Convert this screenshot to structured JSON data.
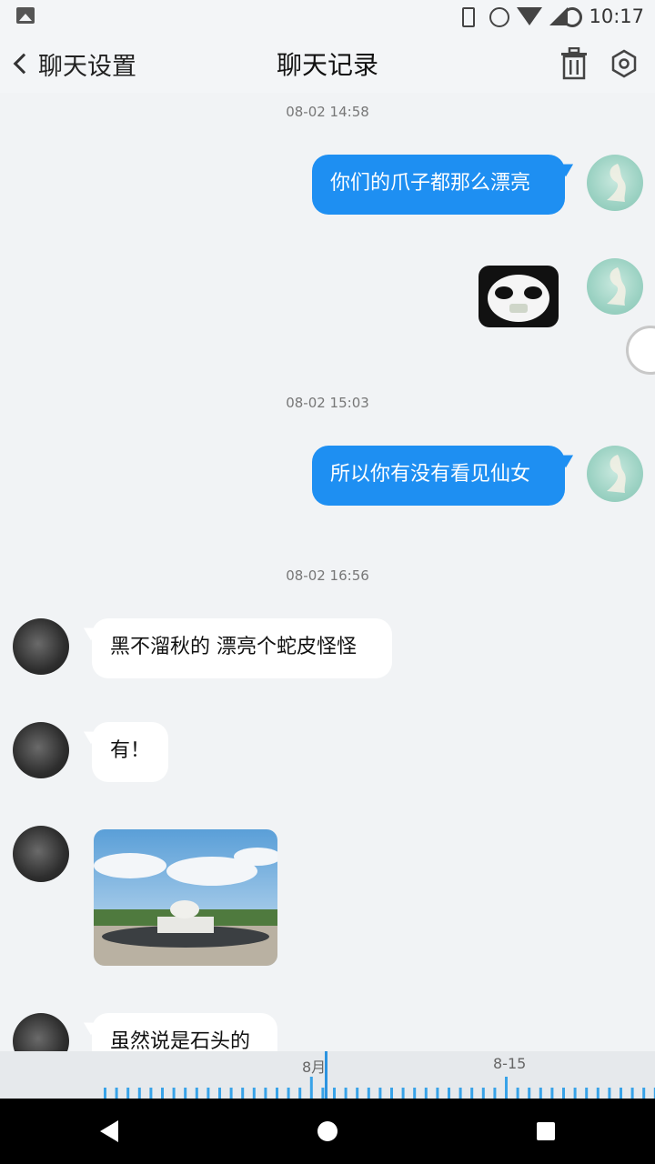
{
  "status_bar": {
    "time": "10:17"
  },
  "header": {
    "back_label": "聊天设置",
    "title": "聊天记录"
  },
  "chat": {
    "timestamps": [
      "08-02 14:58",
      "08-02 15:03",
      "08-02 16:56"
    ],
    "messages": [
      {
        "from": "me",
        "text": "你们的爪子都那么漂亮"
      },
      {
        "from": "me",
        "text": "所以你有没有看见仙女"
      },
      {
        "from": "other",
        "text": "黑不溜秋的 漂亮个蛇皮怪怪"
      },
      {
        "from": "other",
        "text": "有！"
      },
      {
        "from": "other",
        "text": "虽然说是石头的"
      }
    ]
  },
  "timeline": {
    "labels": [
      "8月",
      "8-15"
    ]
  },
  "colors": {
    "accent": "#1e8ff2",
    "background": "#f1f3f5"
  },
  "icons": [
    "image-icon",
    "phone-icon",
    "alarm-icon",
    "wifi-icon",
    "signal-icon",
    "ring-icon",
    "back-icon",
    "trash-icon",
    "settings-icon",
    "nav-back-icon",
    "nav-home-icon",
    "nav-recent-icon"
  ]
}
